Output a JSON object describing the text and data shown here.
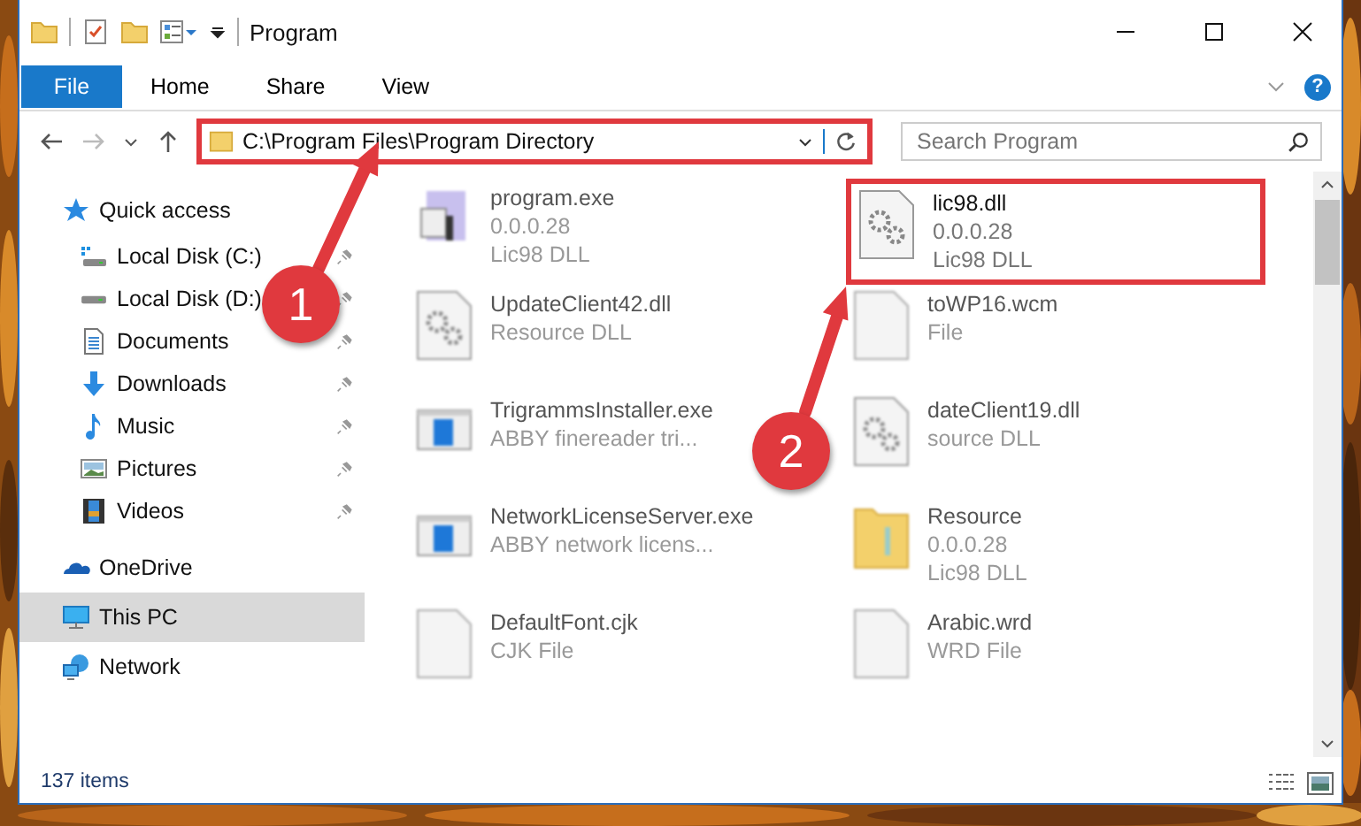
{
  "window": {
    "title": "Program"
  },
  "ribbon": {
    "tabs": [
      {
        "label": "File",
        "kind": "file"
      },
      {
        "label": "Home",
        "kind": "tab"
      },
      {
        "label": "Share",
        "kind": "tab"
      },
      {
        "label": "View",
        "kind": "tab"
      }
    ],
    "help": "?"
  },
  "address": {
    "path": "C:\\Program Files\\Program Directory",
    "highlighted": true
  },
  "search": {
    "placeholder": "Search Program"
  },
  "sidebar": {
    "items": [
      {
        "label": "Quick access",
        "kind": "star",
        "selected": false,
        "children": [
          {
            "label": "Local Disk (C:)",
            "kind": "drive-c",
            "pinned": true
          },
          {
            "label": "Local Disk (D:)",
            "kind": "drive",
            "pinned": true
          },
          {
            "label": "Documents",
            "kind": "documents",
            "pinned": true
          },
          {
            "label": "Downloads",
            "kind": "downloads",
            "pinned": true
          },
          {
            "label": "Music",
            "kind": "music",
            "pinned": true
          },
          {
            "label": "Pictures",
            "kind": "pictures",
            "pinned": true
          },
          {
            "label": "Videos",
            "kind": "videos",
            "pinned": true
          }
        ]
      },
      {
        "label": "OneDrive",
        "kind": "cloud",
        "selected": false
      },
      {
        "label": "This PC",
        "kind": "pc",
        "selected": true
      },
      {
        "label": "Network",
        "kind": "network",
        "selected": false
      }
    ]
  },
  "files": [
    {
      "name": "program.exe",
      "details": [
        "0.0.0.28",
        "Lic98 DLL"
      ],
      "kind": "exe",
      "highlighted": false,
      "blurred": true
    },
    {
      "name": "lic98.dll",
      "details": [
        "0.0.0.28",
        "Lic98 DLL"
      ],
      "kind": "gear",
      "highlighted": true,
      "blurred": false
    },
    {
      "name": "UpdateClient42.dll",
      "details": [
        "Resource DLL"
      ],
      "kind": "gear",
      "highlighted": false,
      "blurred": true
    },
    {
      "name": "toWP16.wcm",
      "details": [
        "File"
      ],
      "kind": "blank",
      "highlighted": false,
      "blurred": true
    },
    {
      "name": "TrigrammsInstaller.exe",
      "details": [
        "ABBY finereader tri..."
      ],
      "kind": "app",
      "highlighted": false,
      "blurred": true
    },
    {
      "name": "dateClient19.dll",
      "details": [
        "source DLL"
      ],
      "kind": "gear",
      "highlighted": false,
      "blurred": true
    },
    {
      "name": "NetworkLicenseServer.exe",
      "details": [
        "ABBY network licens..."
      ],
      "kind": "app",
      "highlighted": false,
      "blurred": true
    },
    {
      "name": "Resource",
      "details": [
        "0.0.0.28",
        "Lic98 DLL"
      ],
      "kind": "folder",
      "highlighted": false,
      "blurred": true
    },
    {
      "name": "DefaultFont.cjk",
      "details": [
        "CJK File"
      ],
      "kind": "blank",
      "highlighted": false,
      "blurred": true
    },
    {
      "name": "Arabic.wrd",
      "details": [
        "WRD File"
      ],
      "kind": "blank",
      "highlighted": false,
      "blurred": true
    }
  ],
  "status_bar": {
    "text": "137 items"
  },
  "annotations": [
    {
      "number": "1",
      "kind": "up-right"
    },
    {
      "number": "2",
      "kind": "up"
    }
  ]
}
